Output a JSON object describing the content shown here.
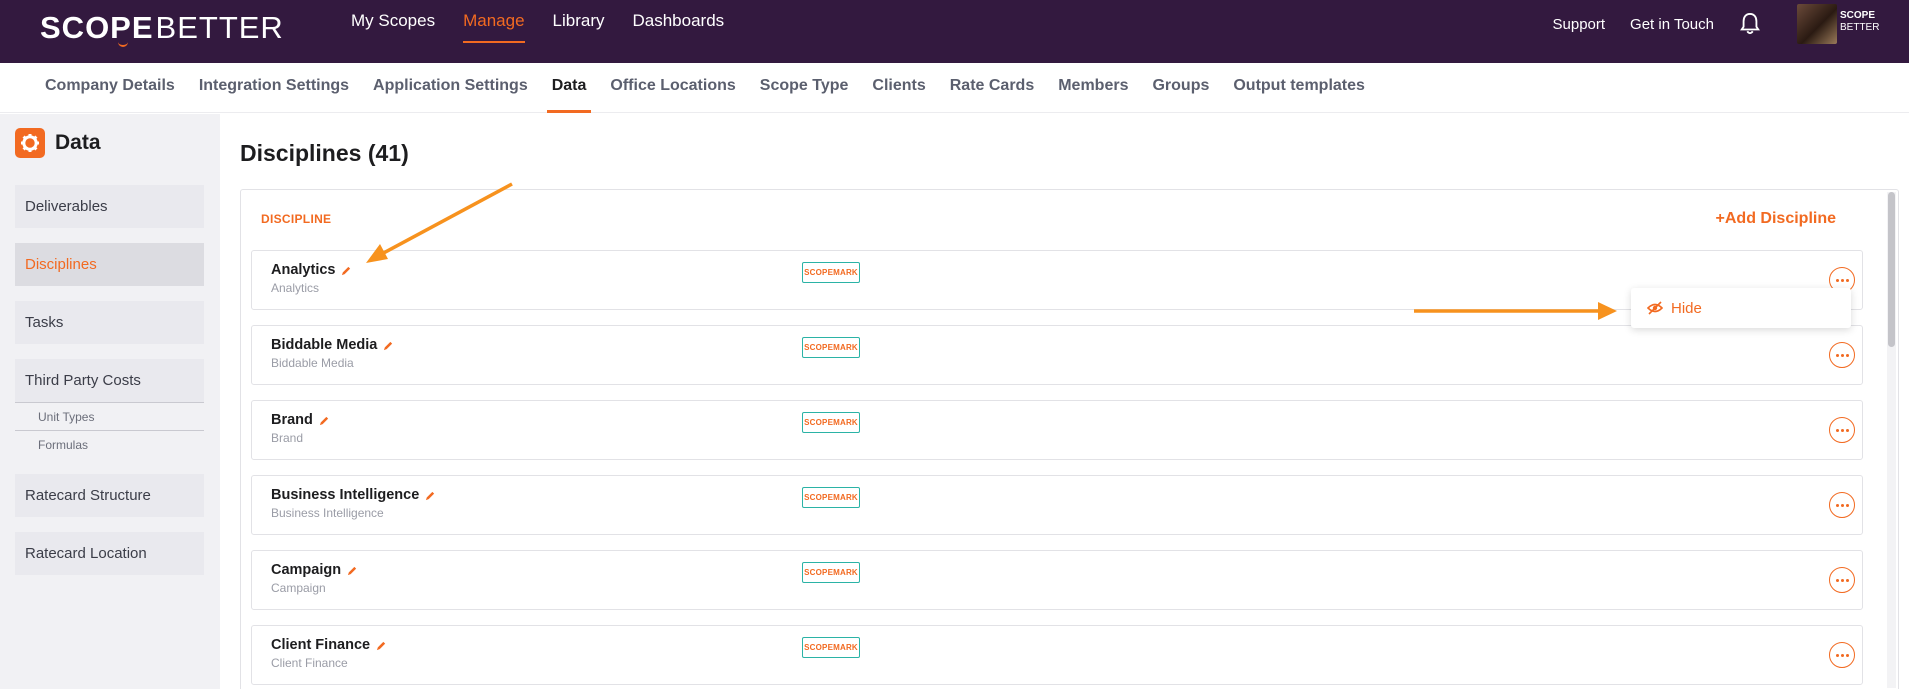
{
  "app": {
    "logo_text_a": "SCOPE",
    "logo_text_b": "BETTER",
    "mini_logo_line1": "SCOPE",
    "mini_logo_line2": "BETTER"
  },
  "topnav": {
    "items": [
      {
        "label": "My Scopes"
      },
      {
        "label": "Manage"
      },
      {
        "label": "Library"
      },
      {
        "label": "Dashboards"
      }
    ],
    "support": "Support",
    "contact": "Get in Touch"
  },
  "subtabs": [
    {
      "label": "Company Details"
    },
    {
      "label": "Integration Settings"
    },
    {
      "label": "Application Settings"
    },
    {
      "label": "Data"
    },
    {
      "label": "Office Locations"
    },
    {
      "label": "Scope Type"
    },
    {
      "label": "Clients"
    },
    {
      "label": "Rate Cards"
    },
    {
      "label": "Members"
    },
    {
      "label": "Groups"
    },
    {
      "label": "Output templates"
    }
  ],
  "sidebar": {
    "title": "Data",
    "items": [
      {
        "label": "Deliverables"
      },
      {
        "label": "Disciplines"
      },
      {
        "label": "Tasks"
      },
      {
        "label": "Third Party Costs"
      },
      {
        "label": "Unit Types"
      },
      {
        "label": "Formulas"
      },
      {
        "label": "Ratecard Structure"
      },
      {
        "label": "Ratecard Location"
      }
    ]
  },
  "main": {
    "title": "Disciplines (41)",
    "column_header": "DISCIPLINE",
    "add_button": "+Add Discipline",
    "badge_label": "SCOPEMARK",
    "rows": [
      {
        "name": "Analytics",
        "sub": "Analytics"
      },
      {
        "name": "Biddable Media",
        "sub": "Biddable Media"
      },
      {
        "name": "Brand",
        "sub": "Brand"
      },
      {
        "name": "Business Intelligence",
        "sub": "Business Intelligence"
      },
      {
        "name": "Campaign",
        "sub": "Campaign"
      },
      {
        "name": "Client Finance",
        "sub": "Client Finance"
      }
    ],
    "menu": {
      "hide_label": "Hide"
    }
  },
  "colors": {
    "accent": "#f26a21",
    "topbar": "#33193f",
    "badge_border": "#2bb3a6"
  }
}
